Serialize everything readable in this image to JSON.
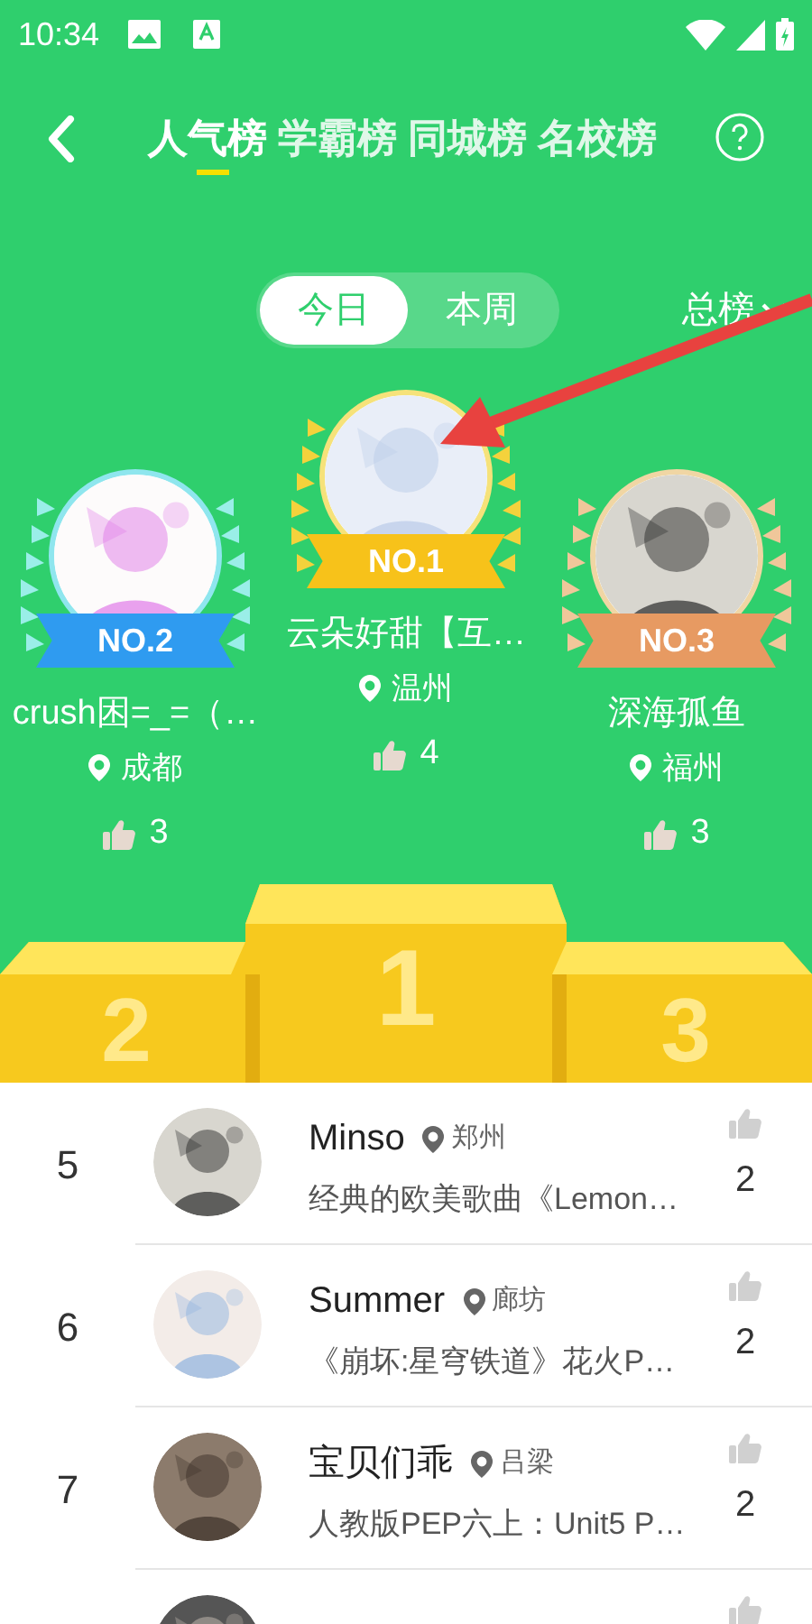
{
  "status_bar": {
    "time": "10:34"
  },
  "header": {
    "tabs": [
      {
        "label": "人气榜",
        "selected": true
      },
      {
        "label": "学霸榜",
        "selected": false
      },
      {
        "label": "同城榜",
        "selected": false
      },
      {
        "label": "名校榜",
        "selected": false
      }
    ]
  },
  "period_tabs": [
    {
      "label": "今日",
      "selected": true
    },
    {
      "label": "本周",
      "selected": false
    }
  ],
  "scope_dropdown": {
    "label": "总榜"
  },
  "top_three": [
    {
      "kind": "second",
      "badge": "NO.2",
      "name": "crush困=_=（…",
      "location": "成都",
      "likes": "3"
    },
    {
      "kind": "first",
      "badge": "NO.1",
      "name": "云朵好甜【互…",
      "location": "温州",
      "likes": "4"
    },
    {
      "kind": "third",
      "badge": "NO.3",
      "name": "深海孤鱼",
      "location": "福州",
      "likes": "3"
    }
  ],
  "podium": [
    "2",
    "1",
    "3"
  ],
  "ranking": [
    {
      "rank": "5",
      "name": "Minso",
      "location": "郑州",
      "description": "经典的欧美歌曲《Lemon…",
      "likes": "2"
    },
    {
      "rank": "6",
      "name": "Summer",
      "location": "廊坊",
      "description": "《崩坏:星穹铁道》花火P…",
      "likes": "2"
    },
    {
      "rank": "7",
      "name": "宝贝们乖",
      "location": "吕梁",
      "description": "人教版PEP六上：Unit5 P…",
      "likes": "2"
    },
    {
      "kind": "picture"
    }
  ]
}
